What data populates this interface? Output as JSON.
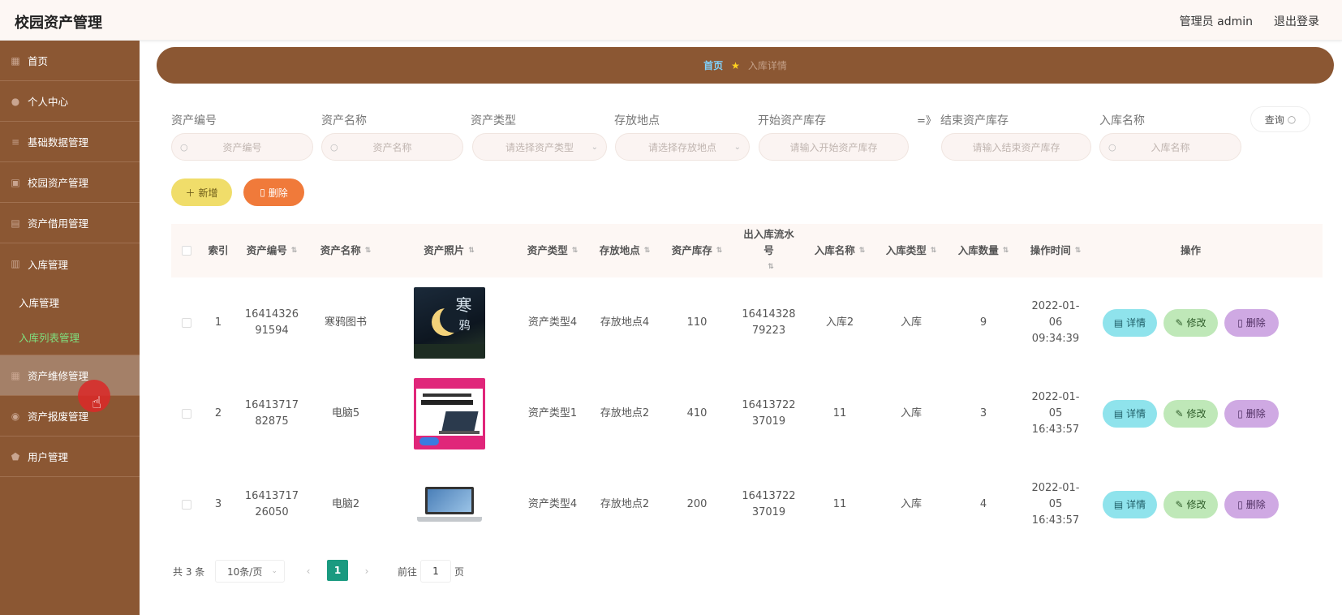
{
  "header": {
    "app_title": "校园资产管理",
    "user": "管理员 admin",
    "logout": "退出登录"
  },
  "sidebar": {
    "items": [
      {
        "label": "首页",
        "icon": "home-icon"
      },
      {
        "label": "个人中心",
        "icon": "user-icon"
      },
      {
        "label": "基础数据管理",
        "icon": "list-icon"
      },
      {
        "label": "校园资产管理",
        "icon": "monitor-icon"
      },
      {
        "label": "资产借用管理",
        "icon": "book-icon"
      },
      {
        "label": "入库管理",
        "icon": "box-icon"
      }
    ],
    "sub_items": [
      {
        "label": "入库管理"
      },
      {
        "label": "入库列表管理"
      }
    ],
    "items_after": [
      {
        "label": "资产维修管理",
        "icon": "tool-icon"
      },
      {
        "label": "资产报废管理",
        "icon": "trash-icon"
      },
      {
        "label": "用户管理",
        "icon": "shield-icon"
      }
    ]
  },
  "breadcrumb": {
    "home": "首页",
    "current": "入库详情"
  },
  "filters": {
    "asset_no": {
      "label": "资产编号",
      "placeholder": "资产编号"
    },
    "asset_name": {
      "label": "资产名称",
      "placeholder": "资产名称"
    },
    "asset_type": {
      "label": "资产类型",
      "placeholder": "请选择资产类型"
    },
    "location": {
      "label": "存放地点",
      "placeholder": "请选择存放地点"
    },
    "stock_start": {
      "label": "开始资产库存",
      "placeholder": "请输入开始资产库存"
    },
    "range_sep": "=》",
    "stock_end": {
      "label": "结束资产库存",
      "placeholder": "请输入结束资产库存"
    },
    "warehouse_name": {
      "label": "入库名称",
      "placeholder": "入库名称"
    },
    "query_label": "查询"
  },
  "actions": {
    "add": "新增",
    "delete": "删除"
  },
  "table": {
    "headers": {
      "index": "索引",
      "asset_no": "资产编号",
      "asset_name": "资产名称",
      "photo": "资产照片",
      "asset_type": "资产类型",
      "location": "存放地点",
      "stock": "资产库存",
      "flow_no": "出入库流水号",
      "in_name": "入库名称",
      "in_type": "入库类型",
      "in_qty": "入库数量",
      "op_time": "操作时间",
      "ops": "操作"
    },
    "rows": [
      {
        "index": "1",
        "asset_no": "1641432691594",
        "asset_name": "寒鸦图书",
        "photo": "book-cover-photo",
        "asset_type": "资产类型4",
        "location": "存放地点4",
        "stock": "110",
        "flow_no": "1641432879223",
        "in_name": "入库2",
        "in_type": "入库",
        "in_qty": "9",
        "op_time": "2022-01-06 09:34:39"
      },
      {
        "index": "2",
        "asset_no": "1641371782875",
        "asset_name": "电脑5",
        "photo": "laptop-ad-photo",
        "asset_type": "资产类型1",
        "location": "存放地点2",
        "stock": "410",
        "flow_no": "1641372237019",
        "in_name": "11",
        "in_type": "入库",
        "in_qty": "3",
        "op_time": "2022-01-05 16:43:57"
      },
      {
        "index": "3",
        "asset_no": "1641371726050",
        "asset_name": "电脑2",
        "photo": "laptop-photo",
        "asset_type": "资产类型4",
        "location": "存放地点2",
        "stock": "200",
        "flow_no": "1641372237019",
        "in_name": "11",
        "in_type": "入库",
        "in_qty": "4",
        "op_time": "2022-01-05 16:43:57"
      }
    ],
    "op_labels": {
      "detail": "详情",
      "edit": "修改",
      "delete": "删除"
    }
  },
  "pagination": {
    "total": "共 3 条",
    "page_size": "10条/页",
    "current": "1",
    "goto_prefix": "前往",
    "goto_value": "1",
    "goto_suffix": "页"
  },
  "colors": {
    "sidebar": "#8b5733",
    "accent_green": "#1a9a80",
    "add": "#f0dd6a",
    "delete": "#f07a3a"
  }
}
